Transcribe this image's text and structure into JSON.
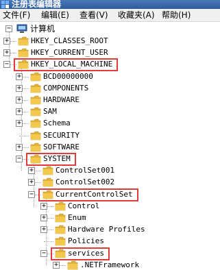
{
  "window": {
    "title": "注册表编辑器"
  },
  "menu": [
    {
      "label": "文件(F)"
    },
    {
      "label": "编辑(E)"
    },
    {
      "label": "查看(V)"
    },
    {
      "label": "收藏夹(A)"
    },
    {
      "label": "帮助(H)"
    }
  ],
  "tree": {
    "root": "计算机",
    "nodes": [
      {
        "label": "HKEY_CLASSES_ROOT",
        "expander": "+"
      },
      {
        "label": "HKEY_CURRENT_USER",
        "expander": "+"
      },
      {
        "label": "HKEY_LOCAL_MACHINE",
        "expander": "−",
        "highlighted": true
      },
      {
        "label": "BCD00000000",
        "expander": "+"
      },
      {
        "label": "COMPONENTS",
        "expander": "+"
      },
      {
        "label": "HARDWARE",
        "expander": "+"
      },
      {
        "label": "SAM",
        "expander": "+"
      },
      {
        "label": "Schema",
        "expander": "+"
      },
      {
        "label": "SECURITY",
        "expander": ""
      },
      {
        "label": "SOFTWARE",
        "expander": "+"
      },
      {
        "label": "SYSTEM",
        "expander": "−",
        "highlighted": true
      },
      {
        "label": "ControlSet001",
        "expander": "+"
      },
      {
        "label": "ControlSet002",
        "expander": "+"
      },
      {
        "label": "CurrentControlSet",
        "expander": "−",
        "highlighted": true
      },
      {
        "label": "Control",
        "expander": "+"
      },
      {
        "label": "Enum",
        "expander": "+"
      },
      {
        "label": "Hardware Profiles",
        "expander": "+"
      },
      {
        "label": "Policies",
        "expander": ""
      },
      {
        "label": "services",
        "expander": "−",
        "highlighted": true
      },
      {
        "label": ".NETFramework",
        "expander": "+"
      }
    ]
  },
  "colors": {
    "highlight": "#e03c3c",
    "folder": "#f2c94c",
    "titlebar": "#2d5c9e"
  }
}
